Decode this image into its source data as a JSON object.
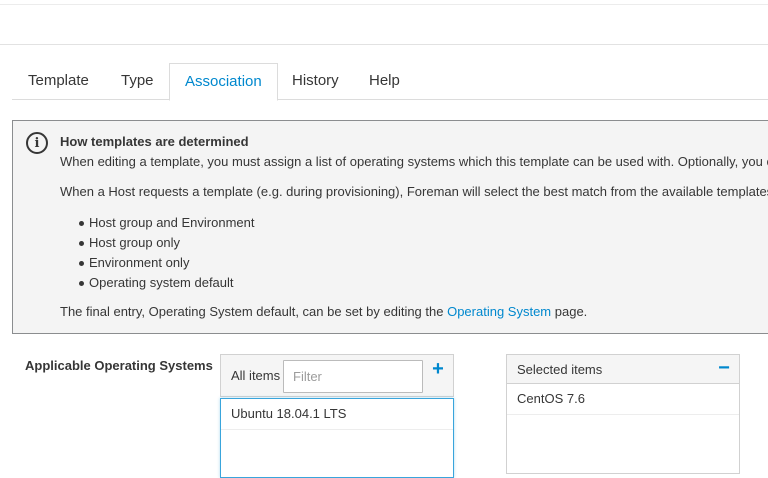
{
  "tabs": [
    {
      "label": "Template"
    },
    {
      "label": "Type"
    },
    {
      "label": "Association",
      "active": true
    },
    {
      "label": "History"
    },
    {
      "label": "Help"
    }
  ],
  "info": {
    "icon": "info-icon",
    "title": "How templates are determined",
    "paragraph1": "When editing a template, you must assign a list of operating systems which this template can be used with. Optionally, you can r",
    "paragraph2": "When a Host requests a template (e.g. during provisioning), Foreman will select the best match from the available templates of t",
    "bullets": [
      "Host group and Environment",
      "Host group only",
      "Environment only",
      "Operating system default"
    ],
    "footer_prefix": "The final entry, Operating System default, can be set by editing the ",
    "footer_link": "Operating System",
    "footer_suffix": " page."
  },
  "association": {
    "label": "Applicable Operating Systems",
    "available": {
      "header": "All items",
      "filter_placeholder": "Filter",
      "add_symbol": "+",
      "items": [
        "Ubuntu 18.04.1 LTS"
      ]
    },
    "selected": {
      "header": "Selected items",
      "remove_symbol": "−",
      "items": [
        "CentOS 7.6"
      ]
    }
  },
  "colors": {
    "accent": "#0088ce",
    "info_background": "#f4f4f4",
    "info_border": "#8b8d8f",
    "text": "#363636"
  }
}
